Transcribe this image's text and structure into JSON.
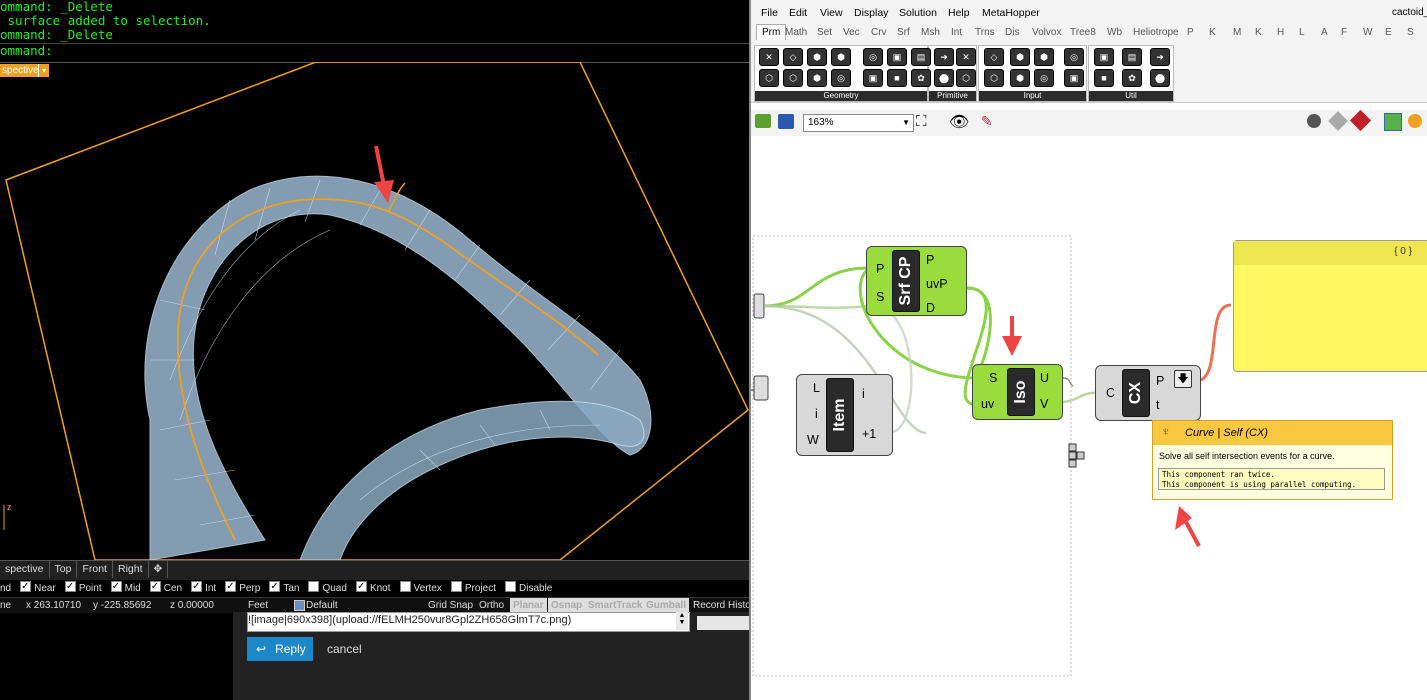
{
  "rhino": {
    "command_lines": [
      "ommand: _Delete",
      " surface added to selection.",
      "ommand: _Delete",
      "ommand:"
    ],
    "viewport_label": "spective",
    "viewport_tabs": [
      "spective",
      "Top",
      "Front",
      "Right"
    ],
    "add_tab_icon": "✥",
    "osnaps": [
      {
        "label": "nd",
        "checked": true
      },
      {
        "label": "Near",
        "checked": true
      },
      {
        "label": "Point",
        "checked": true
      },
      {
        "label": "Mid",
        "checked": true
      },
      {
        "label": "Cen",
        "checked": true
      },
      {
        "label": "Int",
        "checked": true
      },
      {
        "label": "Perp",
        "checked": true
      },
      {
        "label": "Tan",
        "checked": true
      },
      {
        "label": "Quad",
        "checked": false
      },
      {
        "label": "Knot",
        "checked": true
      },
      {
        "label": "Vertex",
        "checked": false
      },
      {
        "label": "Project",
        "checked": false
      },
      {
        "label": "Disable",
        "checked": false
      }
    ],
    "status": {
      "cplane": "ne",
      "x": "x 263.10710",
      "y": "y -225.85692",
      "z": "z 0.00000",
      "units": "Feet",
      "layer": "Default",
      "grid_snap": "Grid Snap",
      "ortho": "Ortho",
      "planar": "Planar",
      "osnap": "Osnap",
      "smarttrack": "SmartTrack",
      "gumball": "Gumball",
      "record_history": "Record History"
    },
    "axis_z_label": "z"
  },
  "forum": {
    "input_text": "![image|690x398](upload://fELMH250vur8Gpl2ZH658GlmT7c.png)",
    "reply_label": "Reply",
    "cancel_label": "cancel"
  },
  "gh": {
    "menu": [
      "File",
      "Edit",
      "View",
      "Display",
      "Solution",
      "Help",
      "MetaHopper"
    ],
    "doc_title": "cactoid_",
    "tabs": [
      "Prm",
      "Math",
      "Set",
      "Vec",
      "Crv",
      "Srf",
      "Msh",
      "Int",
      "Trns",
      "Dis",
      "Volvox",
      "Tree8",
      "Wb",
      "Heliotrope",
      "P",
      "K",
      "M",
      "K",
      "H",
      "L",
      "A",
      "F",
      "W",
      "E",
      "S"
    ],
    "ribbon_groups": [
      "Geometry",
      "Primitive",
      "Input",
      "Util"
    ],
    "zoom": "163%",
    "components": {
      "srfcp": {
        "name": "Srf CP",
        "inputs": [
          "P",
          "S"
        ],
        "outputs": [
          "P",
          "uvP",
          "D"
        ]
      },
      "iso": {
        "name": "Iso",
        "inputs": [
          "S",
          "uv"
        ],
        "outputs": [
          "U",
          "V"
        ]
      },
      "item": {
        "name": "Item",
        "inputs": [
          "L",
          "i",
          "W"
        ],
        "outputs": [
          "i",
          "+1"
        ]
      },
      "cx": {
        "name": "CX",
        "inputs": [
          "C"
        ],
        "outputs": [
          "P",
          "t"
        ]
      }
    },
    "panel_index": "{ 0 }",
    "tooltip": {
      "title": "Curve | Self (CX)",
      "description": "Solve all self intersection events for a curve.",
      "messages": [
        "This component ran twice.",
        "This component is using parallel computing."
      ]
    },
    "colors": {
      "component_green": "#9adc3c",
      "panel_yellow": "#fff860",
      "wire_green": "#8ad24a",
      "arrow_red": "#ef4444"
    }
  }
}
